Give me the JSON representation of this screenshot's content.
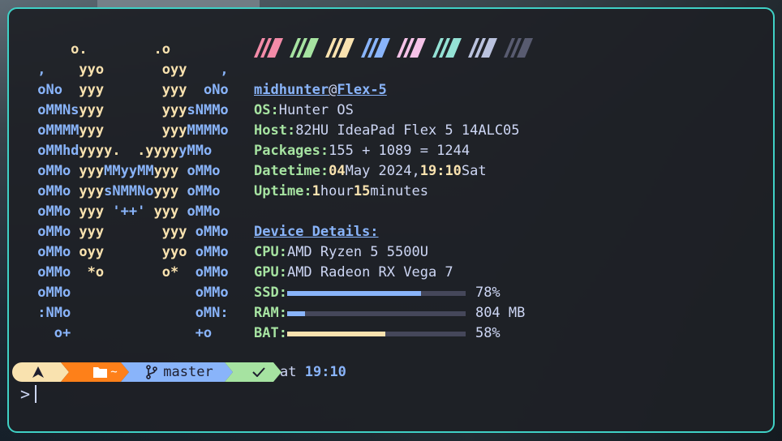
{
  "logo_lines": [
    [
      [
        "y",
        "     o.        .o"
      ]
    ],
    [
      [
        "b",
        " ,    "
      ],
      [
        "y",
        "yyo       oyy    "
      ],
      [
        "b",
        ","
      ]
    ],
    [
      [
        "b",
        " oNo  "
      ],
      [
        "y",
        "yyy       yyy  "
      ],
      [
        "b",
        "oNo"
      ]
    ],
    [
      [
        "b",
        " oMMNs"
      ],
      [
        "y",
        "yyy       yyy"
      ],
      [
        "b",
        "sNMMo"
      ]
    ],
    [
      [
        "b",
        " oMMMM"
      ],
      [
        "y",
        "yyy       yyy"
      ],
      [
        "b",
        "MMMMo"
      ]
    ],
    [
      [
        "b",
        " oMMhd"
      ],
      [
        "y",
        "yyyy.  .yyyy"
      ],
      [
        "b",
        "yMMo"
      ]
    ],
    [
      [
        "b",
        " oMMo "
      ],
      [
        "y",
        "yyy"
      ],
      [
        "b",
        "MMyyMM"
      ],
      [
        "y",
        "yyy "
      ],
      [
        "b",
        "oMMo"
      ]
    ],
    [
      [
        "b",
        " oMMo "
      ],
      [
        "y",
        "yyy"
      ],
      [
        "b",
        "sNMMNo"
      ],
      [
        "y",
        "yyy "
      ],
      [
        "b",
        "oMMo"
      ]
    ],
    [
      [
        "b",
        " oMMo "
      ],
      [
        "y",
        "yyy "
      ],
      [
        "b",
        "'++' "
      ],
      [
        "y",
        "yyy "
      ],
      [
        "b",
        "oMMo"
      ]
    ],
    [
      [
        "b",
        " oMMo "
      ],
      [
        "y",
        "yyy       yyy "
      ],
      [
        "b",
        "oMMo"
      ]
    ],
    [
      [
        "b",
        " oMMo "
      ],
      [
        "y",
        "oyy       yyo "
      ],
      [
        "b",
        "oMMo"
      ]
    ],
    [
      [
        "b",
        " oMMo  "
      ],
      [
        "y",
        "*o       o*  "
      ],
      [
        "b",
        "oMMo"
      ]
    ],
    [
      [
        "b",
        " oMMo               oMMo"
      ]
    ],
    [
      [
        "b",
        " :NMo               oMN:"
      ]
    ],
    [
      [
        "b",
        "   o+               +o"
      ]
    ]
  ],
  "swatches": [
    "#f38ba8",
    "#a6e3a1",
    "#f9e2af",
    "#89b4fa",
    "#f5c2e7",
    "#94e2d5",
    "#bac2de",
    "#585b70"
  ],
  "user": "midhunter",
  "at": "@",
  "host": "Flex-5",
  "info": {
    "os_key": "OS:",
    "os_val": "Hunter OS",
    "host_key": "Host:",
    "host_val": "82HU IdeaPad Flex 5 14ALC05",
    "pkg_key": "Packages:",
    "pkg_val": "155 + 1089 = 1244",
    "dt_key": "Datetime:",
    "dt_day": "04",
    "dt_mid": "May 2024,",
    "dt_time": "19:10",
    "dt_dow": "Sat",
    "up_key": "Uptime:",
    "up_h": "1",
    "up_hl": "hour",
    "up_m": "15",
    "up_ml": "minutes"
  },
  "details_title": "Device Details:",
  "hw": {
    "cpu_key": "CPU:",
    "cpu_val": "AMD Ryzen 5 5500U",
    "gpu_key": "GPU:",
    "gpu_val": "AMD Radeon RX Vega 7",
    "ssd_key": "SSD:",
    "ssd_val": "78%",
    "ssd_frac": 0.75,
    "ram_key": "RAM:",
    "ram_val": "804 MB",
    "ram_frac": 0.1,
    "bat_key": "BAT:",
    "bat_val": "58%",
    "bat_frac": 0.55
  },
  "colors": {
    "ssd": "#89b4fa",
    "ram": "#89b4fa",
    "bat": "#f9e2af"
  },
  "prompt": {
    "os_icon": "arch-icon",
    "folder_icon": "folder-icon",
    "dir": "~",
    "git_icon": "git-branch-icon",
    "branch": "master",
    "status_icon": "check-icon",
    "at_label": "at",
    "time": "19:10",
    "caret_glyph": ">"
  }
}
